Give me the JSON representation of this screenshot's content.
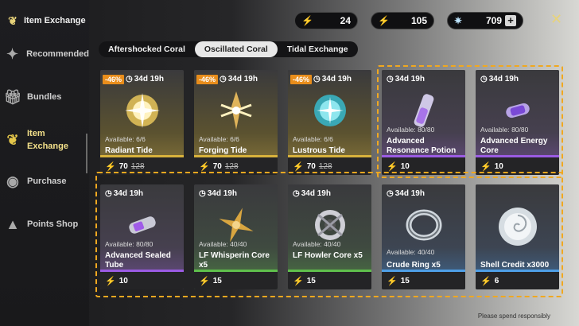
{
  "sidebar": {
    "title": "Item Exchange",
    "items": [
      {
        "label": "Recommended",
        "icon": "recommended-icon"
      },
      {
        "label": "Bundles",
        "icon": "gift-icon"
      },
      {
        "label": "Item\nExchange",
        "icon": "coral-icon"
      },
      {
        "label": "Purchase",
        "icon": "purchase-icon"
      },
      {
        "label": "Points Shop",
        "icon": "points-shop-icon"
      }
    ]
  },
  "currencies": [
    {
      "value": "24",
      "icon": "oscillated-coral-icon"
    },
    {
      "value": "105",
      "icon": "lustrous-tide-currency-icon"
    },
    {
      "value": "709",
      "icon": "astrite-icon"
    }
  ],
  "tabs": [
    "Aftershocked Coral",
    "Oscillated Coral",
    "Tidal Exchange"
  ],
  "selected_tab": "Oscillated Coral",
  "cards": [
    {
      "discount": "-46%",
      "timer": "34d 19h",
      "available": "Available: 6/6",
      "name": "Radiant Tide",
      "price": "70",
      "old_price": "128",
      "rarity": "gold"
    },
    {
      "discount": "-46%",
      "timer": "34d 19h",
      "available": "Available: 6/6",
      "name": "Forging Tide",
      "price": "70",
      "old_price": "128",
      "rarity": "gold"
    },
    {
      "discount": "-46%",
      "timer": "34d 19h",
      "available": "Available: 6/6",
      "name": "Lustrous Tide",
      "price": "70",
      "old_price": "128",
      "rarity": "gold"
    },
    {
      "timer": "34d 19h",
      "available": "Available: 80/80",
      "name": "Advanced Resonance Potion",
      "price": "10",
      "rarity": "purple"
    },
    {
      "timer": "34d 19h",
      "available": "Available: 80/80",
      "name": "Advanced Energy Core",
      "price": "10",
      "rarity": "purple"
    },
    {
      "timer": "34d 19h",
      "available": "Available: 80/80",
      "name": "Advanced Sealed Tube",
      "price": "10",
      "rarity": "purple"
    },
    {
      "timer": "34d 19h",
      "available": "Available: 40/40",
      "name": "LF Whisperin Core x5",
      "price": "15",
      "rarity": "green"
    },
    {
      "timer": "34d 19h",
      "available": "Available: 40/40",
      "name": "LF Howler Core x5",
      "price": "15",
      "rarity": "green"
    },
    {
      "timer": "34d 19h",
      "available": "Available: 40/40",
      "name": "Crude Ring x5",
      "price": "15",
      "rarity": "blue"
    },
    {
      "name": "Shell Credit x3000",
      "price": "6",
      "rarity": "blue"
    }
  ],
  "footer_note": "Please spend responsibly",
  "colors": {
    "accent": "#e8d37a",
    "highlight": "#f0a820",
    "discount": "#e88d1b"
  }
}
